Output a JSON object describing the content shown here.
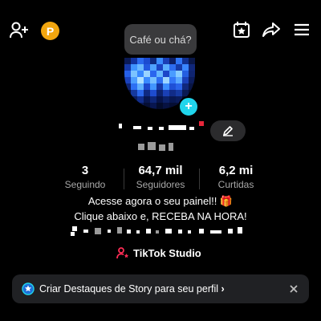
{
  "header": {
    "coin_letter": "P",
    "note_bubble": "Café ou chá?"
  },
  "stats": [
    {
      "value": "3",
      "label": "Seguindo"
    },
    {
      "value": "64,7 mil",
      "label": "Seguidores"
    },
    {
      "value": "6,2 mi",
      "label": "Curtidas"
    }
  ],
  "bio": {
    "line1": "Acesse agora o seu painel!! 🎁",
    "line2": "Clique abaixo e, RECEBA NA HORA!"
  },
  "studio_link": "TikTok Studio",
  "banner": {
    "text": "Criar Destaques de Story para seu perfil",
    "chevron": "›"
  },
  "colors": {
    "background": "#000000",
    "accent_cyan": "#20d5ec",
    "coin_orange": "#f2a60f",
    "studio_pink": "#fe2c55"
  },
  "icons": [
    "add-user-icon",
    "coin-icon",
    "calendar-star-icon",
    "share-icon",
    "menu-icon",
    "pencil-icon",
    "studio-icon",
    "story-icon",
    "close-icon"
  ]
}
